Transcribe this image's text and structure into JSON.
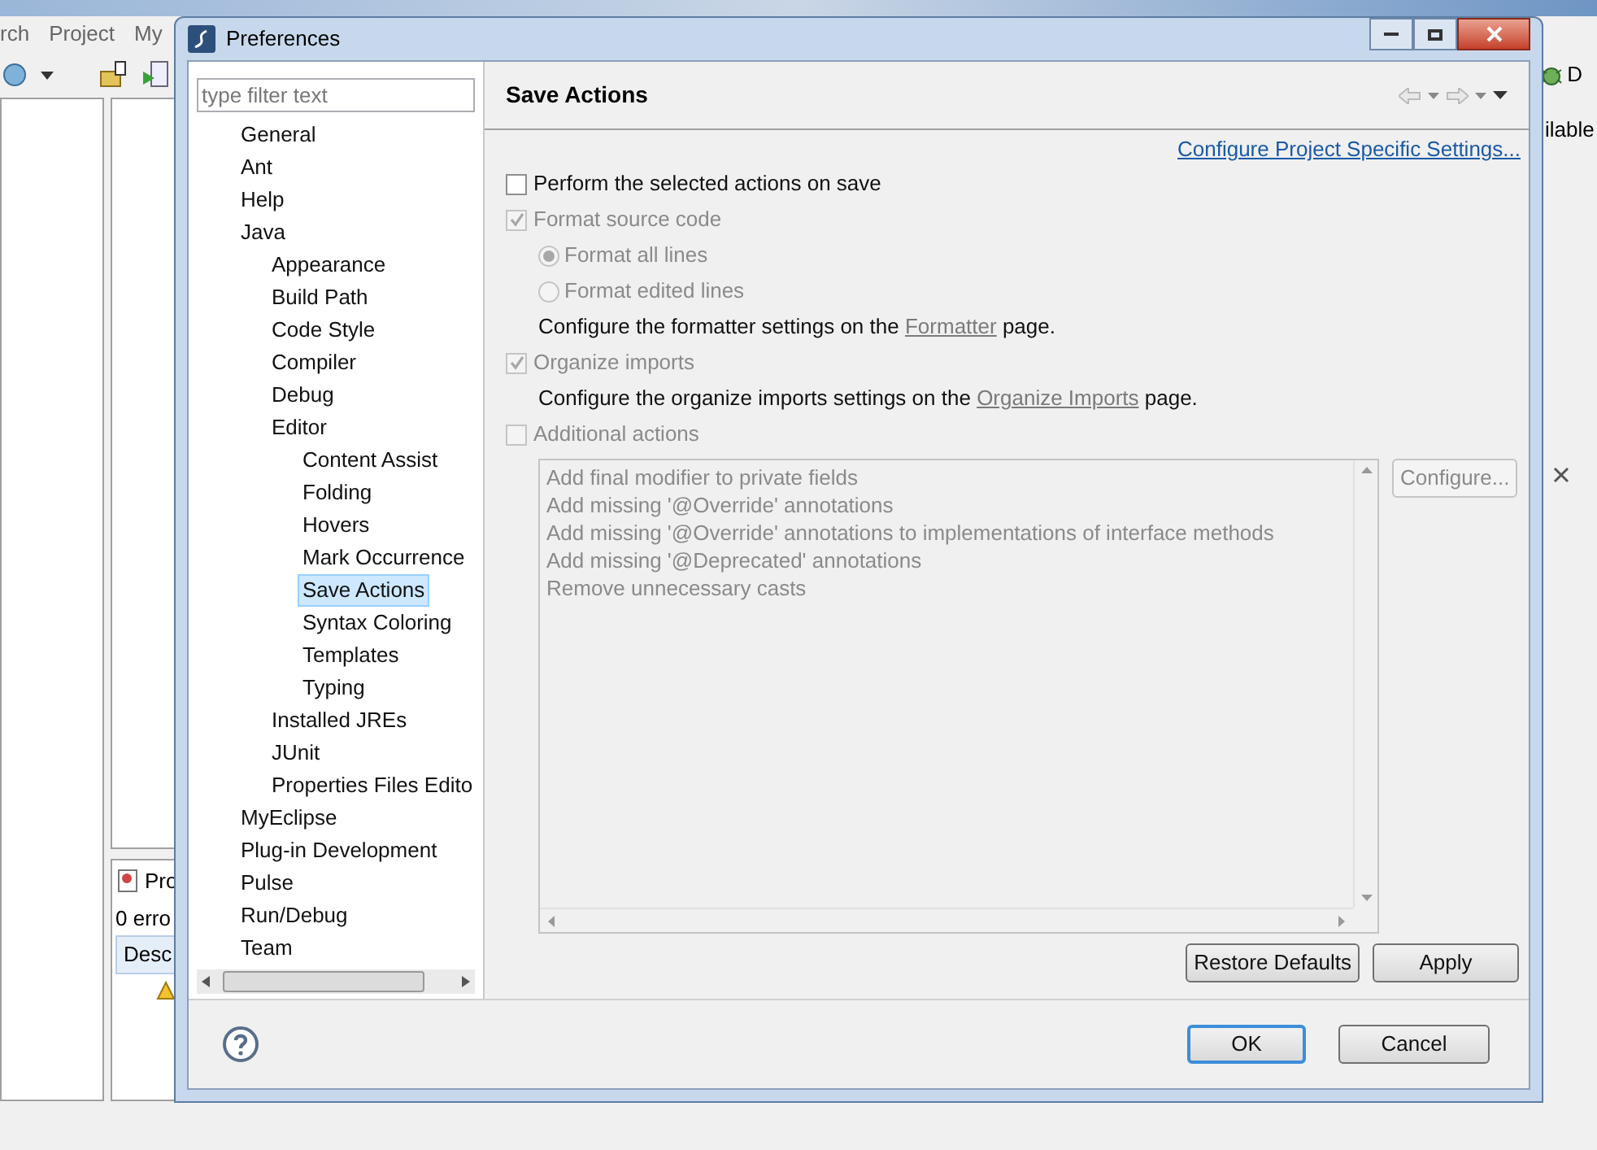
{
  "background": {
    "menu": [
      "rch",
      "Project",
      "My"
    ],
    "side_button": "D",
    "side_text": "ilable",
    "panel_tab": "Pro",
    "panel_status": "0 erro",
    "column_header": "Desc"
  },
  "dialog": {
    "title": "Preferences",
    "filter": {
      "placeholder": "type filter text"
    },
    "tree": [
      {
        "label": "General",
        "selected": false
      },
      {
        "label": "Ant",
        "selected": false
      },
      {
        "label": "Help",
        "selected": false
      },
      {
        "label": "Java",
        "selected": false,
        "children": [
          {
            "label": "Appearance",
            "selected": false
          },
          {
            "label": "Build Path",
            "selected": false
          },
          {
            "label": "Code Style",
            "selected": false
          },
          {
            "label": "Compiler",
            "selected": false
          },
          {
            "label": "Debug",
            "selected": false
          },
          {
            "label": "Editor",
            "selected": false,
            "children": [
              {
                "label": "Content Assist",
                "selected": false
              },
              {
                "label": "Folding",
                "selected": false
              },
              {
                "label": "Hovers",
                "selected": false
              },
              {
                "label": "Mark Occurrence",
                "selected": false
              },
              {
                "label": "Save Actions",
                "selected": true
              },
              {
                "label": "Syntax Coloring",
                "selected": false
              },
              {
                "label": "Templates",
                "selected": false
              },
              {
                "label": "Typing",
                "selected": false
              }
            ]
          },
          {
            "label": "Installed JREs",
            "selected": false
          },
          {
            "label": "JUnit",
            "selected": false
          },
          {
            "label": "Properties Files Edito",
            "selected": false
          }
        ]
      },
      {
        "label": "MyEclipse",
        "selected": false
      },
      {
        "label": "Plug-in Development",
        "selected": false
      },
      {
        "label": "Pulse",
        "selected": false
      },
      {
        "label": "Run/Debug",
        "selected": false
      },
      {
        "label": "Team",
        "selected": false
      }
    ],
    "page": {
      "title": "Save Actions",
      "link": "Configure Project Specific Settings...",
      "options": [
        {
          "kind": "checkbox",
          "label": "Perform the selected actions on save",
          "checked": false,
          "disabled": false
        },
        {
          "kind": "checkbox",
          "label": "Format source code",
          "checked": true,
          "disabled": true,
          "children": [
            {
              "kind": "radio",
              "label": "Format all lines",
              "selected": true,
              "disabled": true
            },
            {
              "kind": "radio",
              "label": "Format edited lines",
              "selected": false,
              "disabled": true
            },
            {
              "kind": "note",
              "text": "Configure the formatter settings on the",
              "link": "Formatter",
              "after": "page.",
              "disabled": true
            }
          ]
        },
        {
          "kind": "checkbox",
          "label": "Organize imports",
          "checked": true,
          "disabled": true,
          "children": [
            {
              "kind": "note",
              "text": "Configure the organize imports settings on the",
              "link": "Organize Imports",
              "after": "page.",
              "disabled": true
            }
          ]
        },
        {
          "kind": "checkbox",
          "label": "Additional actions",
          "checked": false,
          "disabled": true
        }
      ],
      "actions_list": {
        "disabled": true,
        "items": [
          "Add final modifier to private fields",
          "Add missing '@Override' annotations",
          "Add missing '@Override' annotations to implementations of interface methods",
          "Add missing '@Deprecated' annotations",
          "Remove unnecessary casts"
        ]
      },
      "configure_button": {
        "label": "Configure...",
        "disabled": true
      },
      "buttons": [
        "Restore Defaults",
        "Apply"
      ]
    },
    "footer_buttons": [
      {
        "label": "OK",
        "default": true
      },
      {
        "label": "Cancel",
        "default": false
      }
    ]
  }
}
